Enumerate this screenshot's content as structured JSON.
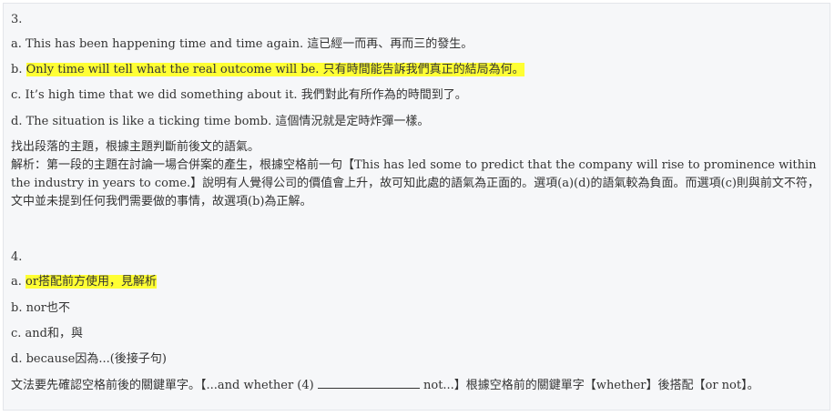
{
  "q3": {
    "number": "3.",
    "a_prefix": "a. ",
    "a_text": "This has been happening time and time again. 這已經一而再、再而三的發生。",
    "b_prefix": "b. ",
    "b_text": "Only time will tell what the real outcome will be. 只有時間能告訴我們真正的結局為何。",
    "c_prefix": "c. ",
    "c_text": "It’s high time that we did something about it. 我們對此有所作為的時間到了。",
    "d_prefix": "d. ",
    "d_text": "The situation is like a ticking time bomb. 這個情況就是定時炸彈一樣。",
    "hint": "找出段落的主題，根據主題判斷前後文的語氣。",
    "explanation": "解析：第一段的主題在討論一場合併案的產生，根據空格前一句【This has led some to predict that the company will rise to prominence within the industry in years to come.】說明有人覺得公司的價值會上升，故可知此處的語氣為正面的。選項(a)(d)的語氣較為負面。而選項(c)則與前文不符，文中並未提到任何我們需要做的事情，故選項(b)為正解。"
  },
  "q4": {
    "number": "4.",
    "a_prefix": "a. ",
    "a_text": "or搭配前方使用，見解析",
    "b_text": "b. nor也不",
    "c_text": "c. and和，與",
    "d_text": "d. because因為...(後接子句)",
    "explanation_before": "文法要先確認空格前後的關鍵單字。【...and whether (4) ",
    "explanation_after": " not...】根據空格前的關鍵單字【whether】後搭配【or not】。"
  },
  "colors": {
    "highlight": "#ffff33",
    "panel_bg": "#f6f7f9",
    "text": "#333333"
  }
}
